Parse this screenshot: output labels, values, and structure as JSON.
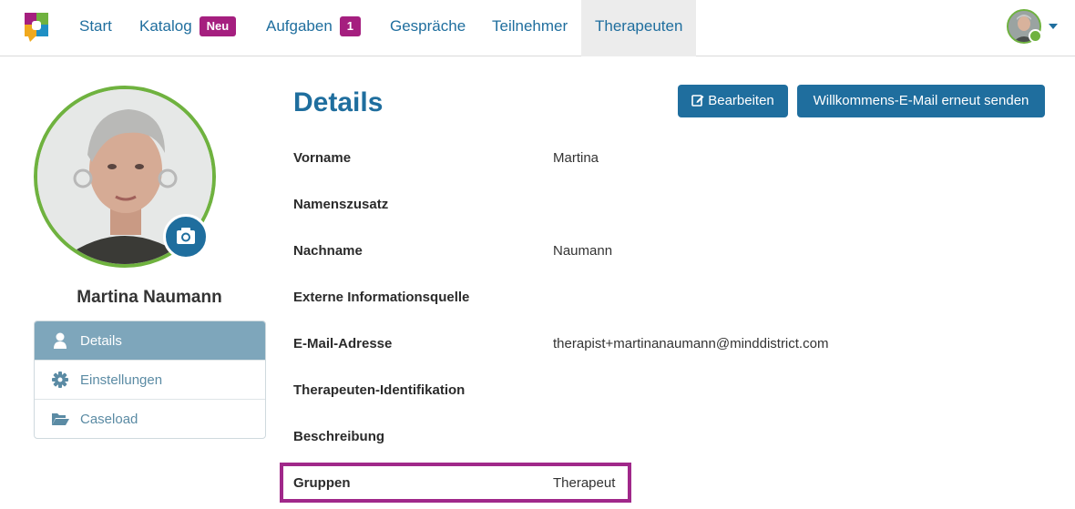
{
  "nav": {
    "items": [
      {
        "label": "Start"
      },
      {
        "label": "Katalog",
        "badge": "Neu"
      },
      {
        "label": "Aufgaben",
        "badge": "1"
      },
      {
        "label": "Gespräche"
      },
      {
        "label": "Teilnehmer"
      },
      {
        "label": "Therapeuten",
        "active": true
      }
    ]
  },
  "profile": {
    "name": "Martina Naumann",
    "menu": [
      {
        "label": "Details",
        "icon": "user-icon",
        "active": true
      },
      {
        "label": "Einstellungen",
        "icon": "gear-icon"
      },
      {
        "label": "Caseload",
        "icon": "folder-open-icon"
      }
    ]
  },
  "main": {
    "title": "Details",
    "edit_label": "Bearbeiten",
    "welcome_label": "Willkommens-E-Mail erneut senden",
    "fields": [
      {
        "label": "Vorname",
        "value": "Martina"
      },
      {
        "label": "Namenszusatz",
        "value": ""
      },
      {
        "label": "Nachname",
        "value": "Naumann"
      },
      {
        "label": "Externe Informationsquelle",
        "value": ""
      },
      {
        "label": "E-Mail-Adresse",
        "value": "therapist+martinanaumann@minddistrict.com"
      },
      {
        "label": "Therapeuten-Identifikation",
        "value": ""
      },
      {
        "label": "Beschreibung",
        "value": ""
      },
      {
        "label": "Gruppen",
        "value": "Therapeut"
      }
    ]
  },
  "colors": {
    "primary": "#1f6e9e",
    "badge": "#a51f7f",
    "avatar_ring": "#6fb23f",
    "highlight": "#a0288a",
    "menu_active": "#7ea6bb"
  }
}
